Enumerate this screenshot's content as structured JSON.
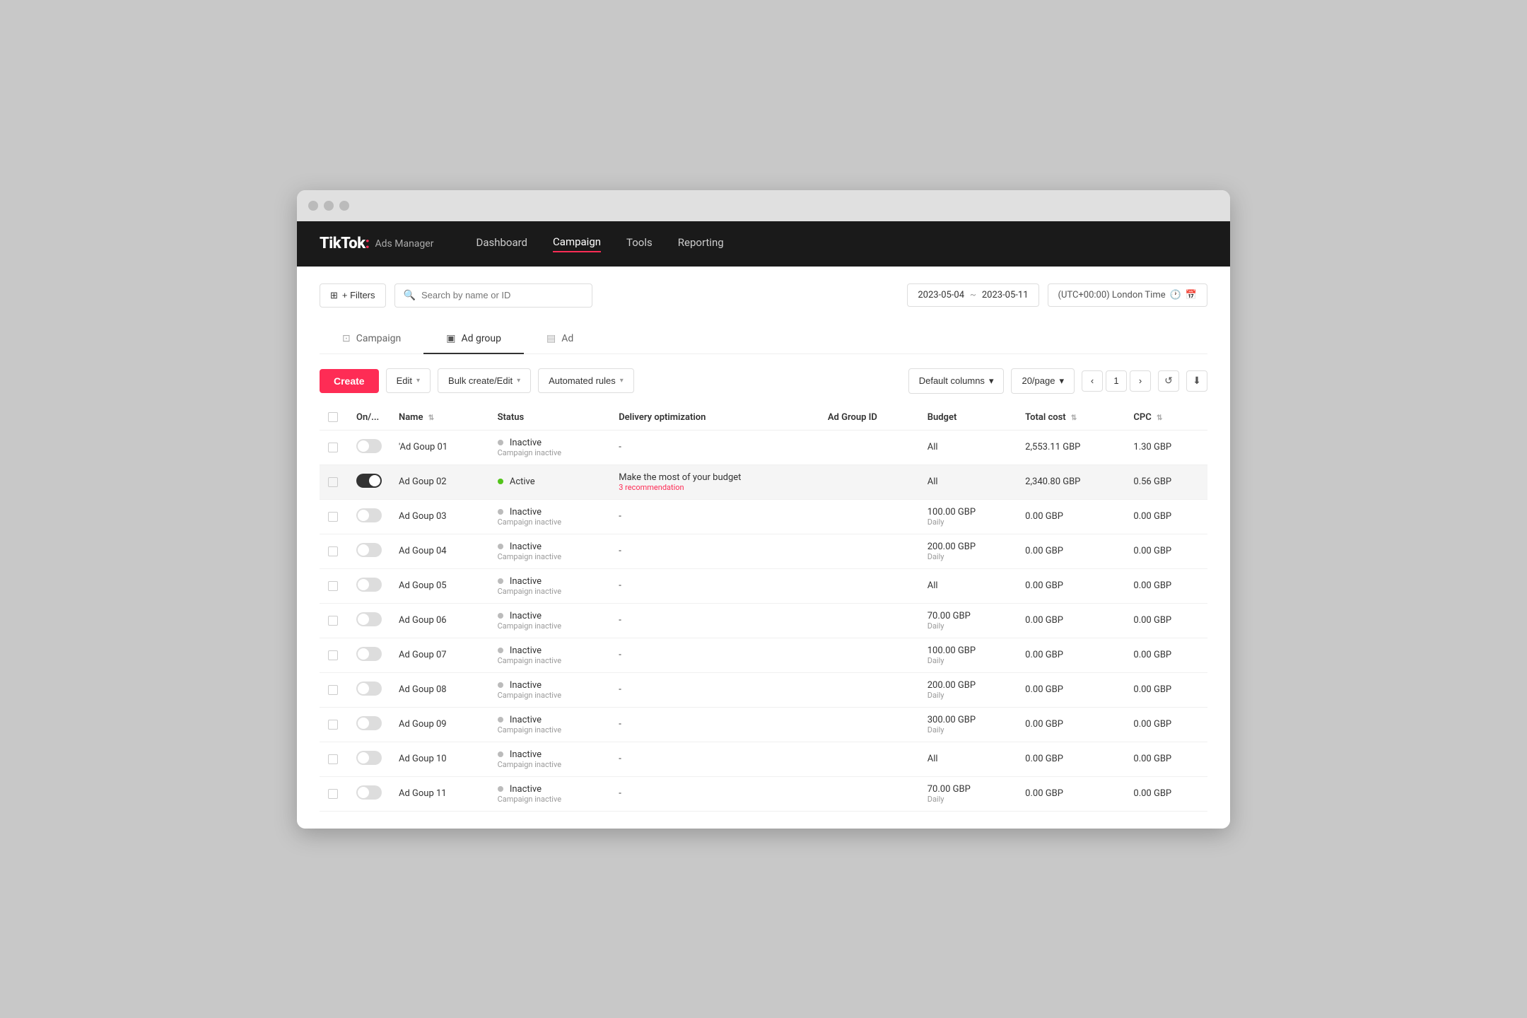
{
  "window": {
    "title": "TikTok Ads Manager"
  },
  "navbar": {
    "brand": "TikTok",
    "brand_dot": ":",
    "brand_sub": "Ads Manager",
    "links": [
      {
        "label": "Dashboard",
        "active": false
      },
      {
        "label": "Campaign",
        "active": true
      },
      {
        "label": "Tools",
        "active": false
      },
      {
        "label": "Reporting",
        "active": false
      }
    ]
  },
  "toolbar": {
    "filters_label": "+ Filters",
    "search_placeholder": "Search by name or ID",
    "date_start": "2023-05-04",
    "date_tilde": "~",
    "date_end": "2023-05-11",
    "timezone": "(UTC+00:00) London Time"
  },
  "tabs": [
    {
      "label": "Campaign",
      "active": false
    },
    {
      "label": "Ad group",
      "active": true
    },
    {
      "label": "Ad",
      "active": false
    }
  ],
  "actions": {
    "create_label": "Create",
    "edit_label": "Edit",
    "bulk_create_label": "Bulk create/Edit",
    "automated_rules_label": "Automated rules",
    "default_columns_label": "Default columns",
    "per_page_label": "20/page",
    "page_current": "1"
  },
  "table": {
    "headers": [
      {
        "label": ""
      },
      {
        "label": "On/..."
      },
      {
        "label": "Name"
      },
      {
        "label": "Status"
      },
      {
        "label": "Delivery optimization"
      },
      {
        "label": "Ad Group ID"
      },
      {
        "label": "Budget"
      },
      {
        "label": "Total cost"
      },
      {
        "label": "CPC"
      }
    ],
    "rows": [
      {
        "id": 1,
        "on": false,
        "name": "'Ad Goup 01",
        "status": "Inactive",
        "status_sub": "Campaign inactive",
        "delivery": "-",
        "delivery_sub": "",
        "ad_group_id": "",
        "budget": "All",
        "budget_sub": "",
        "total_cost": "2,553.11 GBP",
        "cpc": "1.30 GBP",
        "highlighted": false
      },
      {
        "id": 2,
        "on": true,
        "name": "Ad Goup 02",
        "status": "Active",
        "status_sub": "",
        "delivery": "Make the most of your budget",
        "delivery_sub": "3 recommendation",
        "ad_group_id": "",
        "budget": "All",
        "budget_sub": "",
        "total_cost": "2,340.80 GBP",
        "cpc": "0.56 GBP",
        "highlighted": true
      },
      {
        "id": 3,
        "on": false,
        "name": "Ad Goup 03",
        "status": "Inactive",
        "status_sub": "Campaign inactive",
        "delivery": "-",
        "delivery_sub": "",
        "ad_group_id": "",
        "budget": "100.00 GBP",
        "budget_sub": "Daily",
        "total_cost": "0.00 GBP",
        "cpc": "0.00 GBP",
        "highlighted": false
      },
      {
        "id": 4,
        "on": false,
        "name": "Ad Goup 04",
        "status": "Inactive",
        "status_sub": "Campaign inactive",
        "delivery": "-",
        "delivery_sub": "",
        "ad_group_id": "",
        "budget": "200.00 GBP",
        "budget_sub": "Daily",
        "total_cost": "0.00 GBP",
        "cpc": "0.00 GBP",
        "highlighted": false
      },
      {
        "id": 5,
        "on": false,
        "name": "Ad Goup 05",
        "status": "Inactive",
        "status_sub": "Campaign inactive",
        "delivery": "-",
        "delivery_sub": "",
        "ad_group_id": "",
        "budget": "All",
        "budget_sub": "",
        "total_cost": "0.00 GBP",
        "cpc": "0.00 GBP",
        "highlighted": false
      },
      {
        "id": 6,
        "on": false,
        "name": "Ad Goup 06",
        "status": "Inactive",
        "status_sub": "Campaign inactive",
        "delivery": "-",
        "delivery_sub": "",
        "ad_group_id": "",
        "budget": "70.00 GBP",
        "budget_sub": "Daily",
        "total_cost": "0.00 GBP",
        "cpc": "0.00 GBP",
        "highlighted": false
      },
      {
        "id": 7,
        "on": false,
        "name": "Ad Goup 07",
        "status": "Inactive",
        "status_sub": "Campaign inactive",
        "delivery": "-",
        "delivery_sub": "",
        "ad_group_id": "",
        "budget": "100.00 GBP",
        "budget_sub": "Daily",
        "total_cost": "0.00 GBP",
        "cpc": "0.00 GBP",
        "highlighted": false
      },
      {
        "id": 8,
        "on": false,
        "name": "Ad Goup 08",
        "status": "Inactive",
        "status_sub": "Campaign inactive",
        "delivery": "-",
        "delivery_sub": "",
        "ad_group_id": "",
        "budget": "200.00 GBP",
        "budget_sub": "Daily",
        "total_cost": "0.00 GBP",
        "cpc": "0.00 GBP",
        "highlighted": false
      },
      {
        "id": 9,
        "on": false,
        "name": "Ad Goup 09",
        "status": "Inactive",
        "status_sub": "Campaign inactive",
        "delivery": "-",
        "delivery_sub": "",
        "ad_group_id": "",
        "budget": "300.00 GBP",
        "budget_sub": "Daily",
        "total_cost": "0.00 GBP",
        "cpc": "0.00 GBP",
        "highlighted": false
      },
      {
        "id": 10,
        "on": false,
        "name": "Ad Goup 10",
        "status": "Inactive",
        "status_sub": "Campaign inactive",
        "delivery": "-",
        "delivery_sub": "",
        "ad_group_id": "",
        "budget": "All",
        "budget_sub": "",
        "total_cost": "0.00 GBP",
        "cpc": "0.00 GBP",
        "highlighted": false
      },
      {
        "id": 11,
        "on": false,
        "name": "Ad Goup 11",
        "status": "Inactive",
        "status_sub": "Campaign inactive",
        "delivery": "-",
        "delivery_sub": "",
        "ad_group_id": "",
        "budget": "70.00 GBP",
        "budget_sub": "Daily",
        "total_cost": "0.00 GBP",
        "cpc": "0.00 GBP",
        "highlighted": false
      }
    ]
  }
}
